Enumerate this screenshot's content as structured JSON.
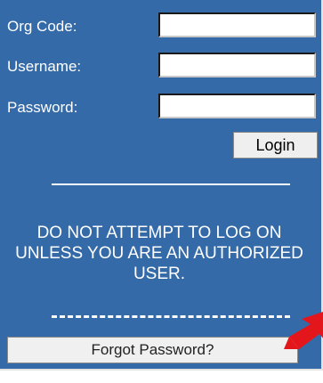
{
  "login_form": {
    "org_code_label": "Org Code:",
    "org_code_value": "",
    "username_label": "Username:",
    "username_value": "",
    "password_label": "Password:",
    "password_value": "",
    "login_button": "Login"
  },
  "warning_text": "DO NOT ATTEMPT TO LOG ON UNLESS YOU ARE AN AUTHORIZED USER.",
  "forgot_password_button": "Forgot Password?",
  "annotation": {
    "arrow_icon": "red-arrow-icon",
    "arrow_color": "#e3161b"
  },
  "colors": {
    "panel_background": "#356aa8",
    "text": "#ffffff"
  }
}
